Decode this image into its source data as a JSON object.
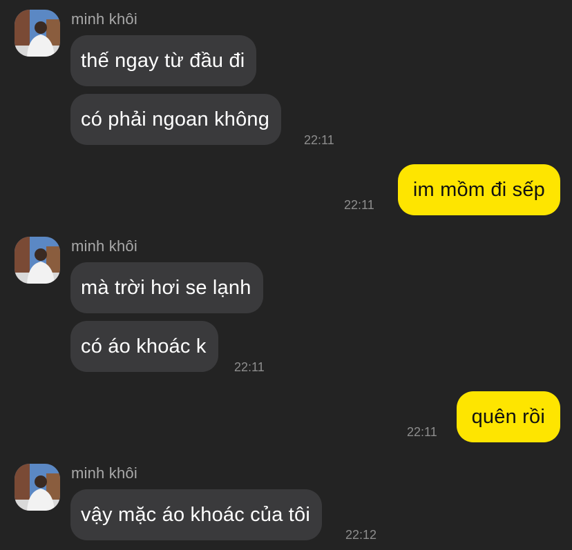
{
  "thread": [
    {
      "sender": "minh khôi",
      "avatar_icon": "profile-photo",
      "messages": [
        "thế ngay từ đầu đi",
        "có phải ngoan không"
      ],
      "time": "22:11"
    },
    {
      "outgoing": "im mồm đi sếp",
      "time": "22:11"
    },
    {
      "sender": "minh khôi",
      "avatar_icon": "profile-photo",
      "messages": [
        "mà trời hơi se lạnh",
        "có áo khoác k"
      ],
      "time": "22:11"
    },
    {
      "outgoing": "quên rồi",
      "time": "22:11"
    },
    {
      "sender": "minh khôi",
      "avatar_icon": "profile-photo",
      "messages": [
        "vậy mặc áo khoác của tôi"
      ],
      "time": "22:12"
    }
  ],
  "colors": {
    "background": "#232323",
    "incoming_bubble": "#3a3a3c",
    "outgoing_bubble": "#fee500",
    "sender_name": "#a9a9a9",
    "timestamp": "#8e8e8e"
  }
}
